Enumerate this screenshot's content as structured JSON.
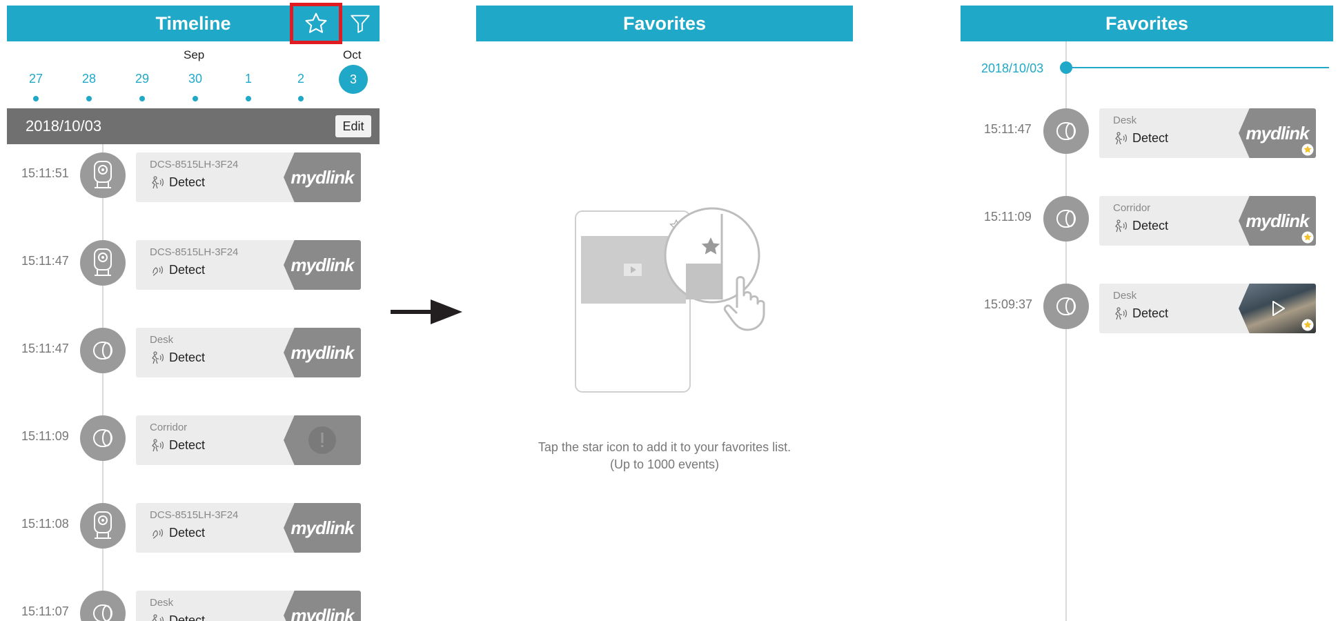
{
  "timeline": {
    "title": "Timeline",
    "month_left": "Sep",
    "month_right": "Oct",
    "days": [
      "27",
      "28",
      "29",
      "30",
      "1",
      "2",
      "3"
    ],
    "selected_day": "3",
    "date": "2018/10/03",
    "edit_label": "Edit",
    "events": [
      {
        "time": "15:11:51",
        "camera": "DCS-8515LH-3F24",
        "type": "Detect",
        "detect_icon": "motion-icon",
        "thumb": "mydlink-logo"
      },
      {
        "time": "15:11:47",
        "camera": "DCS-8515LH-3F24",
        "type": "Detect",
        "detect_icon": "sound-icon",
        "thumb": "mydlink-logo"
      },
      {
        "time": "15:11:47",
        "camera": "Desk",
        "type": "Detect",
        "detect_icon": "motion-icon",
        "thumb": "mydlink-logo"
      },
      {
        "time": "15:11:09",
        "camera": "Corridor",
        "type": "Detect",
        "detect_icon": "motion-icon",
        "thumb": "alert-icon"
      },
      {
        "time": "15:11:08",
        "camera": "DCS-8515LH-3F24",
        "type": "Detect",
        "detect_icon": "sound-icon",
        "thumb": "mydlink-logo"
      },
      {
        "time": "15:11:07",
        "camera": "Desk",
        "type": "Detect",
        "detect_icon": "motion-icon",
        "thumb": "mydlink-logo"
      }
    ],
    "logo_text": "mydlink"
  },
  "favorites_empty": {
    "title": "Favorites",
    "message_line1": "Tap the star icon to add it to your favorites list.",
    "message_line2": "(Up to 1000 events)"
  },
  "favorites": {
    "title": "Favorites",
    "date": "2018/10/03",
    "events": [
      {
        "time": "15:11:47",
        "camera": "Desk",
        "type": "Detect",
        "thumb": "mydlink-logo"
      },
      {
        "time": "15:11:09",
        "camera": "Corridor",
        "type": "Detect",
        "thumb": "mydlink-logo"
      },
      {
        "time": "15:09:37",
        "camera": "Desk",
        "type": "Detect",
        "thumb": "photo"
      }
    ]
  },
  "colors": {
    "accent": "#1fa8c8",
    "highlight": "#e11b22",
    "date_bar": "#707070"
  }
}
